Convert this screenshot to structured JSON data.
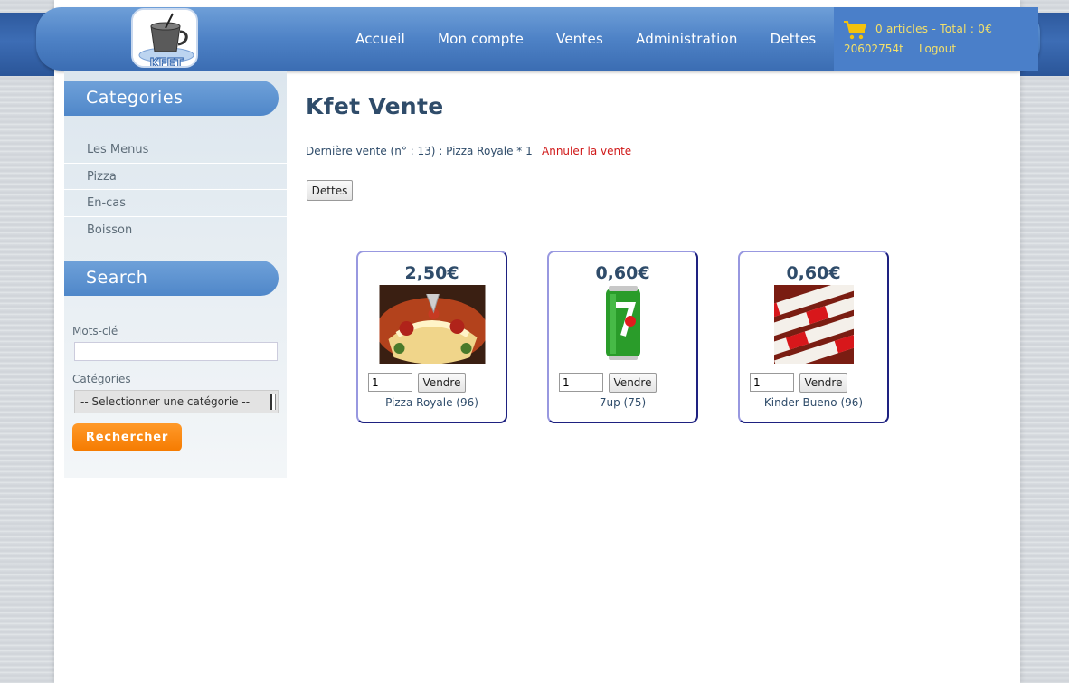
{
  "nav": {
    "items": [
      "Accueil",
      "Mon compte",
      "Ventes",
      "Administration",
      "Dettes"
    ]
  },
  "cart": {
    "summary": "0 articles - Total : 0€",
    "user": "20602754t",
    "logout": "Logout",
    "icon": "cart-icon"
  },
  "sidebar": {
    "categories_title": "Categories",
    "categories": [
      "Les Menus",
      "Pizza",
      "En-cas",
      "Boisson"
    ],
    "search_title": "Search",
    "keywords_label": "Mots-clé",
    "keywords_value": "",
    "category_label": "Catégories",
    "category_selected": "-- Selectionner une catégorie --",
    "search_button": "Rechercher"
  },
  "main": {
    "title": "Kfet Vente",
    "last_sale": "Dernière vente (n° : 13) : Pizza Royale * 1",
    "cancel_sale": "Annuler la vente",
    "debts_button": "Dettes",
    "products": [
      {
        "price": "2,50€",
        "qty": "1",
        "sell": "Vendre",
        "name": "Pizza Royale (96)"
      },
      {
        "price": "0,60€",
        "qty": "1",
        "sell": "Vendre",
        "name": "7up (75)"
      },
      {
        "price": "0,60€",
        "qty": "1",
        "sell": "Vendre",
        "name": "Kinder Bueno (96)"
      }
    ]
  },
  "colors": {
    "nav_blue": "#4e82c6",
    "title_blue": "#2f4c6a",
    "cart_yellow": "#f4e06a",
    "cancel_red": "#d01818",
    "search_orange": "#f57b00"
  }
}
